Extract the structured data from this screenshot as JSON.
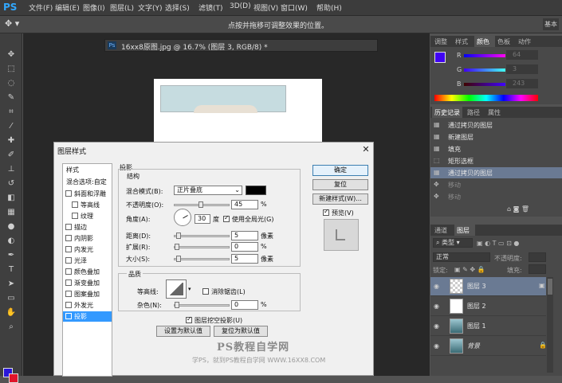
{
  "menubar": {
    "logo": "PS",
    "items": [
      "文件(F)",
      "编辑(E)",
      "图像(I)",
      "图层(L)",
      "文字(Y)",
      "选择(S)",
      "滤镜(T)",
      "3D(D)",
      "视图(V)",
      "窗口(W)",
      "帮助(H)"
    ]
  },
  "optionsbar": {
    "hint": "点按并拖移可调整效果的位置。",
    "workspace": "基本"
  },
  "document": {
    "tab_icon": "Ps",
    "tab_title": "16xx8原图.jpg @ 16.7% (图层 3, RGB/8) *"
  },
  "color_panel": {
    "tabs": [
      "调整",
      "样式",
      "颜色",
      "色板",
      "动作"
    ],
    "active_tab": "颜色",
    "r_label": "R",
    "g_label": "G",
    "b_label": "B",
    "r_value": "64",
    "g_value": "3",
    "b_value": "243",
    "foreground": "#4003f3"
  },
  "history_panel": {
    "tabs": [
      "历史记录",
      "路径",
      "属性"
    ],
    "active_tab": "历史记录",
    "items": [
      {
        "label": "通过拷贝的图层",
        "state": "normal"
      },
      {
        "label": "新建图层",
        "state": "normal"
      },
      {
        "label": "填充",
        "state": "normal"
      },
      {
        "label": "矩形选框",
        "state": "normal"
      },
      {
        "label": "通过拷贝的图层",
        "state": "selected"
      },
      {
        "label": "移动",
        "state": "dimmed"
      },
      {
        "label": "移动",
        "state": "dimmed"
      }
    ]
  },
  "layers_panel": {
    "tabs": [
      "通道",
      "图层"
    ],
    "active_tab": "图层",
    "filter_label": "类型",
    "blend_mode": "正常",
    "opacity_label": "不透明度:",
    "lock_label": "锁定:",
    "fill_label": "填充:",
    "layers": [
      {
        "name": "图层 3",
        "selected": true,
        "thumb": "checker"
      },
      {
        "name": "图层 2",
        "selected": false,
        "thumb": "white"
      },
      {
        "name": "图层 1",
        "selected": false,
        "thumb": "photo"
      },
      {
        "name": "背景",
        "selected": false,
        "thumb": "photo"
      }
    ]
  },
  "dialog": {
    "title": "图层样式",
    "styles_header": "样式",
    "blend_header": "混合选项:自定",
    "styles": [
      {
        "label": "斜面和浮雕",
        "indent": 0,
        "checked": false
      },
      {
        "label": "等高线",
        "indent": 1,
        "checked": false
      },
      {
        "label": "纹理",
        "indent": 1,
        "checked": false
      },
      {
        "label": "描边",
        "indent": 0,
        "checked": false
      },
      {
        "label": "内阴影",
        "indent": 0,
        "checked": false
      },
      {
        "label": "内发光",
        "indent": 0,
        "checked": false
      },
      {
        "label": "光泽",
        "indent": 0,
        "checked": false
      },
      {
        "label": "颜色叠加",
        "indent": 0,
        "checked": false
      },
      {
        "label": "渐变叠加",
        "indent": 0,
        "checked": false
      },
      {
        "label": "图案叠加",
        "indent": 0,
        "checked": false
      },
      {
        "label": "外发光",
        "indent": 0,
        "checked": false
      },
      {
        "label": "投影",
        "indent": 0,
        "checked": true,
        "selected": true
      }
    ],
    "section_title": "投影",
    "structure_title": "结构",
    "blend_mode_label": "混合模式(B):",
    "blend_mode_value": "正片叠底",
    "opacity_label": "不透明度(O):",
    "opacity_value": "45",
    "angle_label": "角度(A):",
    "angle_value": "30",
    "angle_unit": "度",
    "global_light_label": "使用全局光(G)",
    "distance_label": "距离(D):",
    "distance_value": "5",
    "spread_label": "扩展(R):",
    "spread_value": "0",
    "size_label": "大小(S):",
    "size_value": "5",
    "px_unit": "像素",
    "pct_unit": "%",
    "quality_title": "品质",
    "contour_label": "等高线:",
    "antialias_label": "消除锯齿(L)",
    "noise_label": "杂色(N):",
    "noise_value": "0",
    "knockout_label": "图层挖空投影(U)",
    "set_default_label": "设置为默认值",
    "reset_default_label": "复位为默认值",
    "ok_label": "确定",
    "reset_label": "复位",
    "new_style_label": "新建样式(W)...",
    "preview_label": "预览(V)",
    "shadow_color": "#000000"
  },
  "watermark": {
    "line1": "PS教程自学网",
    "line2": "学PS，就到PS教程自学网 WWW.16XX8.COM"
  }
}
